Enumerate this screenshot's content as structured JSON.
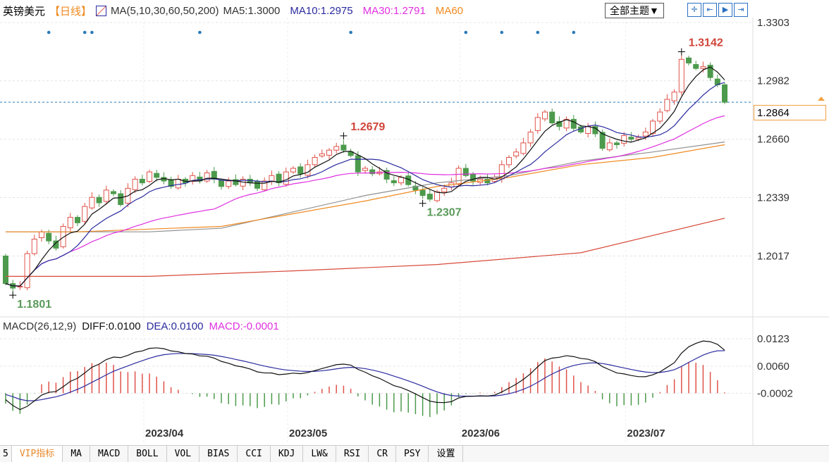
{
  "header": {
    "symbol": "英镑美元",
    "period": "【日线】",
    "ma_label": "MA(5,10,30,60,50,200)",
    "ma5": "MA5:1.3000",
    "ma10": "MA10:1.2975",
    "ma30": "MA30:1.2791",
    "ma60": "MA60",
    "theme_button": "全部主题▼",
    "tool_icons": [
      "crosshair-icon",
      "zoom-range-icon",
      "play-forward-icon",
      "goto-end-icon"
    ]
  },
  "colors": {
    "up": "#e0534a",
    "down": "#4c9a4c",
    "ma5": "#111111",
    "ma10": "#2b2ba0",
    "ma30": "#e030e0",
    "ma60": "#f08a20",
    "ma50": "#909090",
    "ma200": "#d84a3a",
    "current": "#f0a040",
    "dot": "#2a7ab8"
  },
  "chart_data": {
    "type": "candlestick",
    "y_ticks": [
      "1.3303",
      "1.2982",
      "1.2660",
      "1.2339",
      "1.2017"
    ],
    "ylim": [
      1.175,
      1.3365
    ],
    "current_price": "1.2864",
    "closes": [
      1.1865,
      1.184,
      1.185,
      1.203,
      1.211,
      1.215,
      1.21,
      1.206,
      1.218,
      1.223,
      1.22,
      1.229,
      1.234,
      1.231,
      1.238,
      1.236,
      1.23,
      1.239,
      1.244,
      1.242,
      1.248,
      1.245,
      1.243,
      1.24,
      1.244,
      1.242,
      1.246,
      1.243,
      1.2475,
      1.244,
      1.24,
      1.243,
      1.241,
      1.244,
      1.242,
      1.239,
      1.243,
      1.246,
      1.242,
      1.248,
      1.25,
      1.247,
      1.252,
      1.256,
      1.258,
      1.26,
      1.262,
      1.26,
      1.257,
      1.248,
      1.25,
      1.247,
      1.248,
      1.244,
      1.242,
      1.245,
      1.241,
      1.238,
      1.235,
      1.233,
      1.237,
      1.239,
      1.242,
      1.25,
      1.246,
      1.243,
      1.244,
      1.242,
      1.245,
      1.252,
      1.256,
      1.259,
      1.264,
      1.27,
      1.278,
      1.281,
      1.275,
      1.273,
      1.277,
      1.272,
      1.27,
      1.273,
      1.269,
      1.261,
      1.264,
      1.263,
      1.268,
      1.266,
      1.267,
      1.27,
      1.276,
      1.281,
      1.288,
      1.292,
      1.31,
      1.308,
      1.305,
      1.306,
      1.3,
      1.296,
      1.2864
    ],
    "first_open": 1.2017,
    "ma60_points": [
      [
        0,
        1.215
      ],
      [
        10,
        1.215
      ],
      [
        30,
        1.218
      ],
      [
        50,
        1.232
      ],
      [
        60,
        1.24
      ],
      [
        70,
        1.245
      ],
      [
        80,
        1.252
      ],
      [
        90,
        1.256
      ],
      [
        100,
        1.263
      ]
    ],
    "ma50_points": [
      [
        0,
        1.215
      ],
      [
        20,
        1.215
      ],
      [
        30,
        1.217
      ],
      [
        50,
        1.235
      ],
      [
        60,
        1.242
      ],
      [
        70,
        1.246
      ],
      [
        80,
        1.254
      ],
      [
        90,
        1.259
      ],
      [
        100,
        1.2645
      ]
    ],
    "ma200_points": [
      [
        0,
        1.1905
      ],
      [
        20,
        1.1905
      ],
      [
        40,
        1.1935
      ],
      [
        60,
        1.197
      ],
      [
        80,
        1.2035
      ],
      [
        100,
        1.2225
      ]
    ],
    "annotations": [
      {
        "index": 94,
        "label": "1.3142",
        "price": 1.3142,
        "kind": "high"
      },
      {
        "index": 47,
        "label": "1.2679",
        "price": 1.2679,
        "kind": "high"
      },
      {
        "index": 58,
        "label": "1.2307",
        "price": 1.2307,
        "kind": "low"
      },
      {
        "index": 1,
        "label": "1.1801",
        "price": 1.1801,
        "kind": "low"
      }
    ],
    "event_dots": [
      6,
      11,
      12,
      27,
      48,
      64,
      69,
      74,
      79
    ],
    "x_labels": [
      {
        "index": 20,
        "label": "2023/04"
      },
      {
        "index": 40,
        "label": "2023/05"
      },
      {
        "index": 64,
        "label": "2023/06"
      },
      {
        "index": 87,
        "label": "2023/07"
      }
    ],
    "macd": {
      "title": "MACD(26,12,9)",
      "diff": "DIFF:0.0100",
      "dea": "DEA:0.0100",
      "macd": "MACD:-0.0001",
      "y_ticks": [
        "0.0123",
        "0.0060",
        "-0.0002"
      ],
      "ylim": [
        -0.0075,
        0.015
      ]
    }
  },
  "tabs": [
    "5",
    "VIP指标",
    "MA",
    "MACD",
    "BOLL",
    "VOL",
    "BIAS",
    "CCI",
    "KDJ",
    "LW&",
    "RSI",
    "CR",
    "PSY",
    "设置"
  ]
}
